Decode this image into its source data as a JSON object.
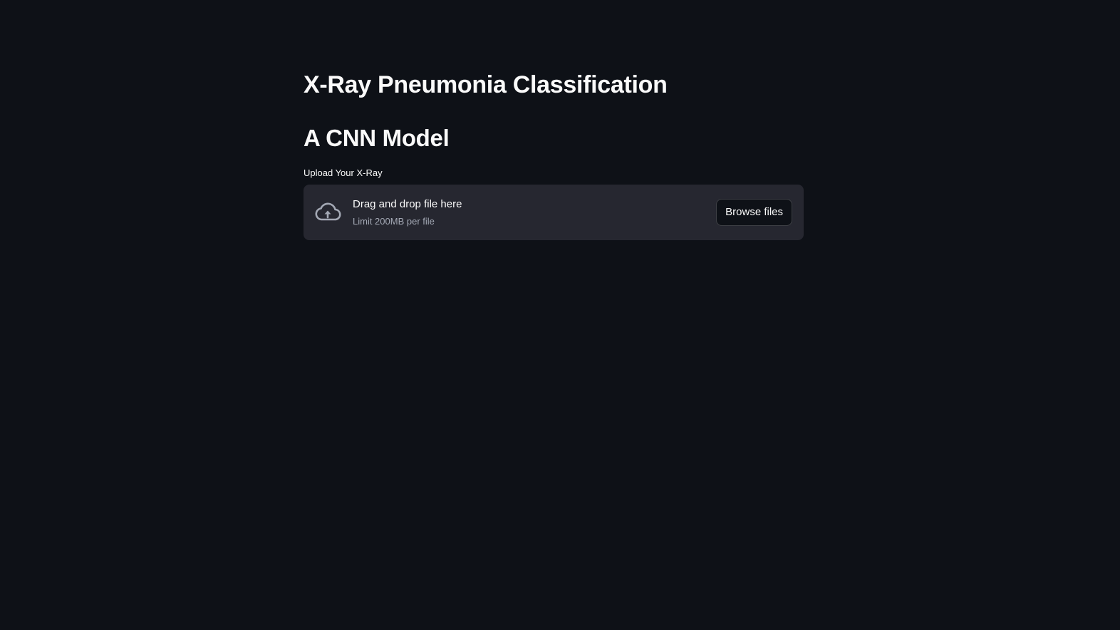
{
  "page": {
    "title": "X-Ray Pneumonia Classification",
    "subtitle": "A CNN Model"
  },
  "uploader": {
    "label": "Upload Your X-Ray",
    "drag_text": "Drag and drop file here",
    "limit_text": "Limit 200MB per file",
    "browse_label": "Browse files",
    "icon": "cloud-upload-icon"
  },
  "colors": {
    "background": "#0e1117",
    "dropzone": "#262730",
    "text": "#fafafa",
    "muted_text": "#a3a8b4"
  }
}
